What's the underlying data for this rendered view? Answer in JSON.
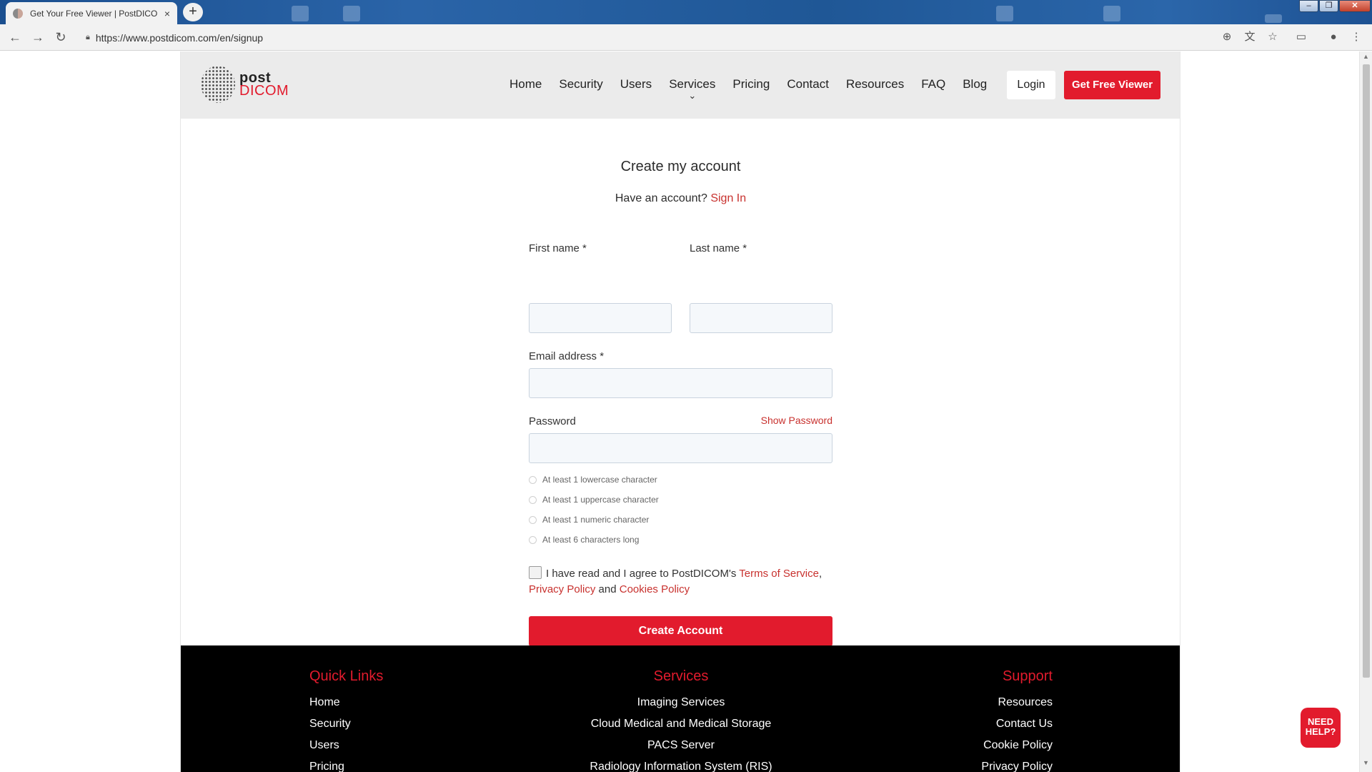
{
  "browser": {
    "tab_title": "Get Your Free Viewer | PostDICOM",
    "tab_close": "×",
    "new_tab": "+",
    "url": "https://www.postdicom.com/en/signup",
    "window_controls": [
      "–",
      "❐",
      "✕"
    ]
  },
  "header": {
    "logo_post": "post",
    "logo_dicom": "DICOM",
    "nav": [
      "Home",
      "Security",
      "Users",
      "Services",
      "Pricing",
      "Contact",
      "Resources",
      "FAQ",
      "Blog"
    ],
    "services_chevron": "⌄",
    "login_label": "Login",
    "free_viewer_label": "Get Free Viewer"
  },
  "form": {
    "title": "Create my account",
    "have_account": "Have an account?",
    "sign_in": "Sign In",
    "first_name_label": "First name *",
    "last_name_label": "Last name *",
    "email_label": "Email address *",
    "password_label": "Password",
    "show_password": "Show Password",
    "password_rules": [
      "At least 1 lowercase character",
      "At least 1 uppercase character",
      "At least 1 numeric character",
      "At least 6 characters long"
    ],
    "terms_prefix": "I have read and I agree to PostDICOM's",
    "terms_of_service": "Terms of Service",
    "privacy_policy": "Privacy Policy",
    "and_word": "and",
    "cookies_policy": "Cookies Policy",
    "create_account": "Create Account"
  },
  "footer": {
    "quick_links": {
      "title": "Quick Links",
      "items": [
        "Home",
        "Security",
        "Users",
        "Pricing"
      ]
    },
    "services": {
      "title": "Services",
      "items": [
        "Imaging Services",
        "Cloud Medical and Medical Storage",
        "PACS Server",
        "Radiology Information System (RIS)"
      ]
    },
    "support": {
      "title": "Support",
      "items": [
        "Resources",
        "Contact Us",
        "Cookie Policy",
        "Privacy Policy"
      ]
    }
  },
  "need_help": {
    "line1": "NEED",
    "line2": "HELP?"
  },
  "colors": {
    "brand_red": "#e21b2d",
    "link_red": "#c8312e",
    "header_gray": "#ebebeb",
    "footer_black": "#000000"
  },
  "icons": [
    "back-arrow-icon",
    "forward-arrow-icon",
    "reload-icon",
    "lock-icon",
    "translate-icon",
    "bookmark-star-icon",
    "cast-icon",
    "account-icon",
    "menu-dots-icon"
  ]
}
